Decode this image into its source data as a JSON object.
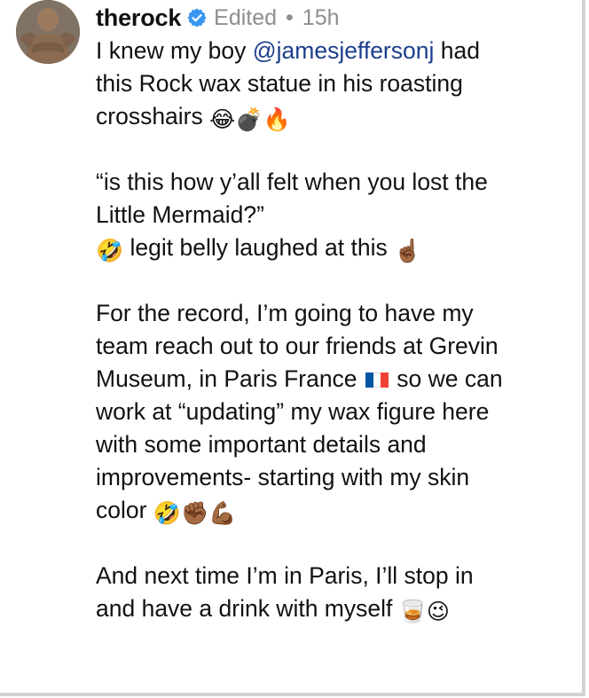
{
  "post": {
    "username": "therock",
    "status": "Edited",
    "separator": "•",
    "time": "15h",
    "verified_icon": "verified-badge-icon",
    "accent_color": "#3897f0",
    "mention_color": "#1d3f8c"
  },
  "caption": {
    "p1": {
      "l1a": "I knew my boy ",
      "mention": "@jamesjeffersonj",
      "l1b": " had",
      "l2": "this Rock wax statue in his roasting",
      "l3": "crosshairs ",
      "l3_emoji": "😂💣🔥"
    },
    "p2": {
      "l1": "“is this how y’all felt when you lost the",
      "l2": "Little Mermaid?”",
      "l3_emoji_a": "🤣",
      "l3": " legit belly laughed at this ",
      "l3_emoji_b": "☝🏾"
    },
    "p3": {
      "l1": "For the record, I’m going to have my",
      "l2": "team reach out to our friends at Grevin",
      "l3a": "Museum, in Paris France ",
      "l3b": " so we can",
      "l4": "work at “updating” my wax figure here",
      "l5": "with some important details and",
      "l6": "improvements- starting with my skin",
      "l7": "color ",
      "l7_emoji": "🤣✊🏾💪🏾"
    },
    "p4": {
      "l1": "And next time I’m in Paris, I’ll stop in",
      "l2": "and have a drink with myself ",
      "l2_emoji": "🥃😉"
    }
  },
  "icons": {
    "avatar": "avatar",
    "flag": "france-flag-icon"
  }
}
